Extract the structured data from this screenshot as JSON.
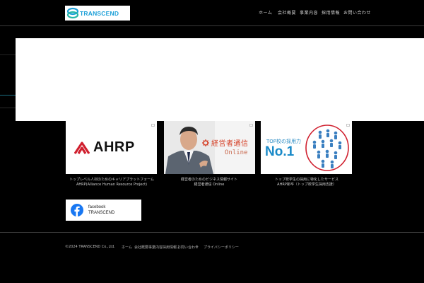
{
  "header": {
    "logo_text": "TRANSCEND",
    "nav": [
      {
        "label": "ホーム"
      },
      {
        "label": "会社概要"
      },
      {
        "label": "事業内容"
      },
      {
        "label": "採用情報"
      },
      {
        "label": "お問い合わせ"
      }
    ]
  },
  "cards": [
    {
      "logo_text": "AHRP",
      "caption_line1": "トップレベル人材のためのキャリアプラットフォーム",
      "caption_line2": "AHRP(Alliance Human Resource Project)"
    },
    {
      "title": "経営者通信",
      "subtitle": "Online",
      "caption_line1": "経営者のためのビジネス情報サイト",
      "caption_line2": "経営者通信 Online"
    },
    {
      "subtitle": "TOP校の採用力",
      "headline": "No.1",
      "caption_line1": "トップ校学生の採用に特化したサービス",
      "caption_line2": "AHRP新卒（トップ校学生採用支援）"
    }
  ],
  "facebook": {
    "line1": "facebook",
    "line2": "TRANSCEND"
  },
  "footer": {
    "copyright": "©2024 TRANSCEND Co.,Ltd.",
    "links": [
      {
        "label": "ホーム"
      },
      {
        "label": "会社概要"
      },
      {
        "label": "事業内容"
      },
      {
        "label": "採用情報"
      },
      {
        "label": "お問い合わせ"
      },
      {
        "label": "/"
      },
      {
        "label": "プライバシーポリシー"
      }
    ]
  },
  "colors": {
    "background": "#000000",
    "brand_blue": "#1da0d8",
    "ahrp_red": "#d0202f",
    "facebook_blue": "#1877f2"
  },
  "icons": [
    "transcend-logo-icon",
    "ahrp-logo-icon",
    "gear-icon",
    "people-icon",
    "facebook-icon"
  ]
}
